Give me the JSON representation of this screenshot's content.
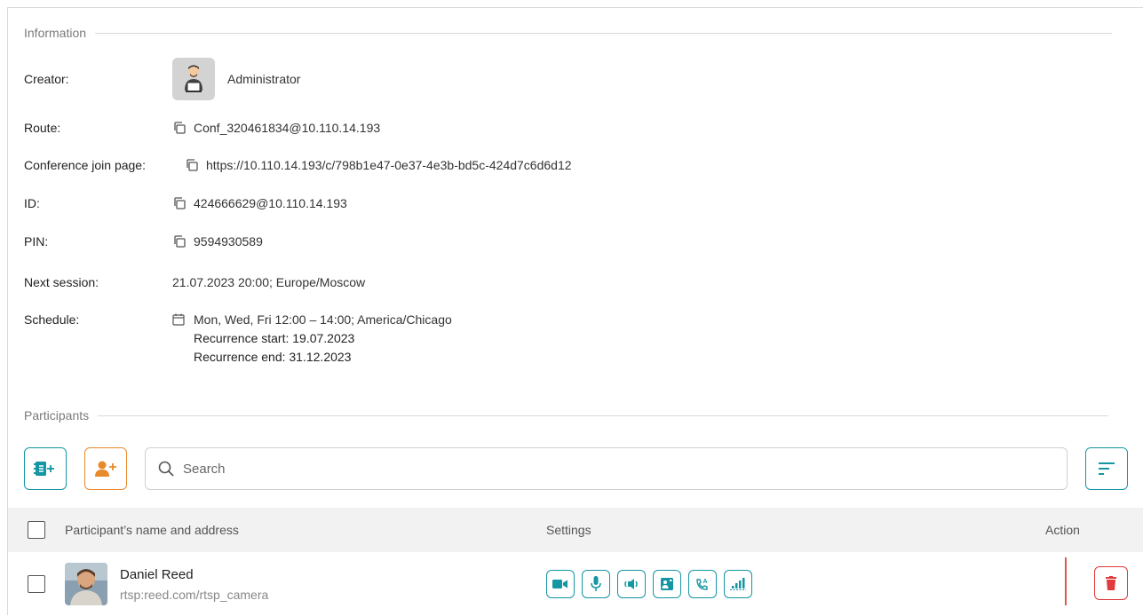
{
  "information": {
    "section_title": "Information",
    "creator": {
      "label": "Creator:",
      "value": "Administrator"
    },
    "route": {
      "label": "Route:",
      "value": "Conf_320461834@10.110.14.193"
    },
    "join_page": {
      "label": "Conference join page:",
      "value": "https://10.110.14.193/c/798b1e47-0e37-4e3b-bd5c-424d7c6d6d12"
    },
    "id": {
      "label": "ID:",
      "value": "424666629@10.110.14.193"
    },
    "pin": {
      "label": "PIN:",
      "value": "9594930589"
    },
    "next_session": {
      "label": "Next session:",
      "value": "21.07.2023 20:00; Europe/Moscow"
    },
    "schedule": {
      "label": "Schedule:",
      "value": "Mon, Wed, Fri 12:00 – 14:00; America/Chicago",
      "recurrence_start": "Recurrence start: 19.07.2023",
      "recurrence_end": "Recurrence end: 31.12.2023"
    }
  },
  "participants": {
    "section_title": "Participants",
    "search_placeholder": "Search",
    "columns": {
      "name": "Participant’s name and address",
      "settings": "Settings",
      "action": "Action"
    },
    "rows": [
      {
        "name": "Daniel Reed",
        "address": "rtsp:reed.com/rtsp_camera"
      }
    ]
  },
  "colors": {
    "teal": "#1496a3",
    "orange": "#e8892b",
    "red": "#e03a3a"
  }
}
